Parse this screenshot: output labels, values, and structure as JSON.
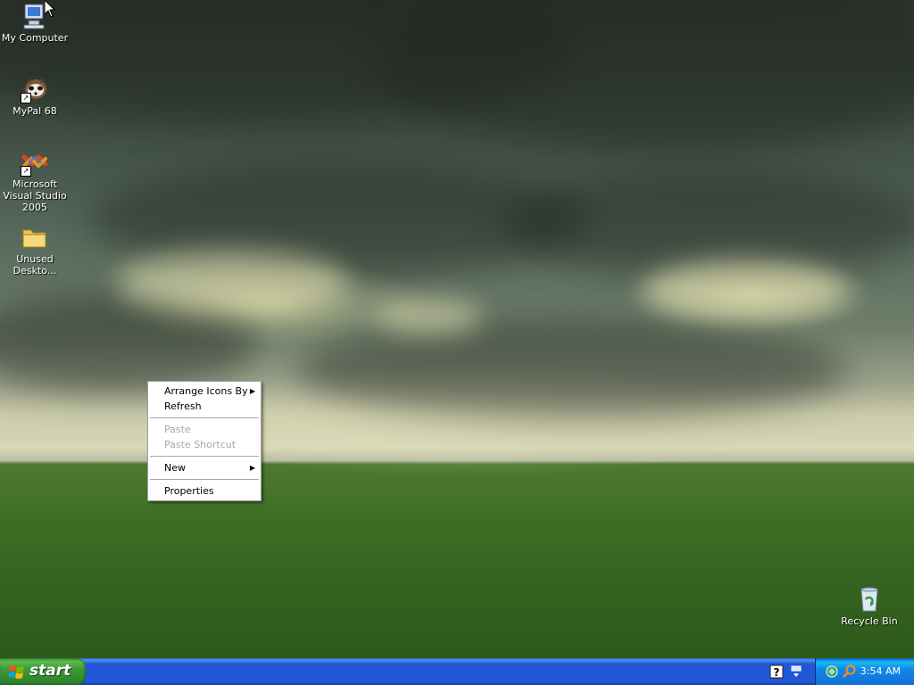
{
  "desktop": {
    "icons": [
      {
        "label": "My Computer",
        "icon": "my-computer-icon"
      },
      {
        "label": "MyPal 68",
        "icon": "mypal-icon"
      },
      {
        "label": "Microsoft Visual Studio 2005",
        "icon": "visual-studio-icon"
      },
      {
        "label": "Unused Deskto...",
        "icon": "folder-icon"
      },
      {
        "label": "Recycle Bin",
        "icon": "recycle-bin-icon"
      }
    ]
  },
  "context_menu": {
    "items": [
      {
        "label": "Arrange Icons By",
        "enabled": true,
        "submenu": true
      },
      {
        "label": "Refresh",
        "enabled": true,
        "submenu": false
      },
      {
        "label": "Paste",
        "enabled": false,
        "submenu": false
      },
      {
        "label": "Paste Shortcut",
        "enabled": false,
        "submenu": false
      },
      {
        "label": "New",
        "enabled": true,
        "submenu": true
      },
      {
        "label": "Properties",
        "enabled": true,
        "submenu": false
      }
    ],
    "submenu_arrow": "▶"
  },
  "taskbar": {
    "start_label": "start",
    "clock": "3:54 AM",
    "icons": [
      "help-icon",
      "safely-remove-icon",
      "network-icon",
      "search-icon"
    ]
  },
  "colors": {
    "taskbar_blue": "#2157d7",
    "start_green": "#3d9a3a",
    "tray_blue": "#1288e8",
    "disabled_text": "#a7a6aa"
  }
}
